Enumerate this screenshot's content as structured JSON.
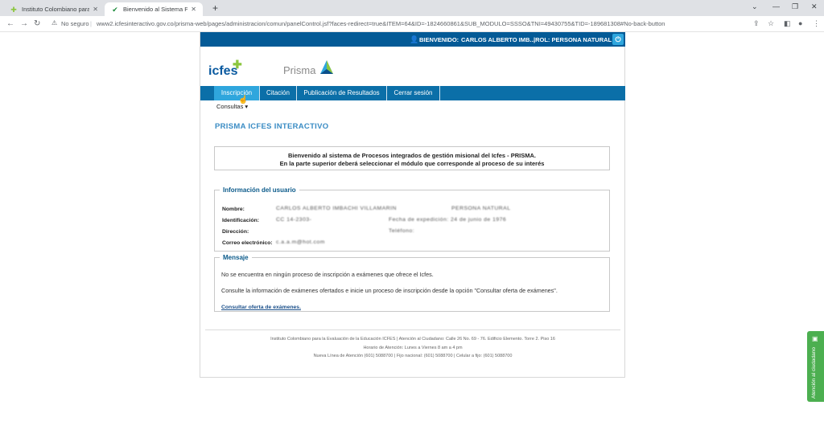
{
  "browser": {
    "tabs": [
      {
        "title": "Instituto Colombiano para la Eva",
        "active": false
      },
      {
        "title": "Bienvenido al Sistema PRISMA",
        "active": true
      }
    ],
    "security_label": "No seguro",
    "url": "www2.icfesinteractivo.gov.co/prisma-web/pages/administracion/comun/panelControl.jsf?faces-redirect=true&ITEM=64&ID=-1824660861&SUB_MODULO=SSSO&TNI=49430755&TID=-189681308#No-back-button"
  },
  "header": {
    "welcome_label": "BIENVENIDO:",
    "user_name": "CARLOS ALBERTO IMB...",
    "role_label": "|ROL:",
    "role_value": "PERSONA NATURAL"
  },
  "logos": {
    "icfes": "icfes",
    "prisma": "Prisma"
  },
  "menu": {
    "items": [
      "Inscripción",
      "Citación",
      "Publicación de Resultados",
      "Cerrar sesión"
    ],
    "submenu": "Consultas ▾"
  },
  "main": {
    "title": "PRISMA ICFES INTERACTIVO",
    "welcome_line1": "Bienvenido al sistema de Procesos integrados de gestión misional del Icfes - PRISMA.",
    "welcome_line2": "En la parte superior deberá seleccionar el módulo que corresponde al proceso de su interés"
  },
  "user_info": {
    "legend": "Información del usuario",
    "labels": {
      "nombre": "Nombre:",
      "identificacion": "Identificación:",
      "direccion": "Dirección:",
      "correo": "Correo electrónico:"
    },
    "blurred": {
      "nombre": "CARLOS ALBERTO IMBACHI VILLAMARIN",
      "rol": "PERSONA NATURAL",
      "identificacion": "CC 14-2303-",
      "fecha": "Fecha de expedición: 24 de junio de 1976",
      "telefono": "Teléfono:",
      "correo": "c.a.a.m@hot.com"
    }
  },
  "message": {
    "legend": "Mensaje",
    "line1": "No se encuentra en ningún proceso de inscripción a exámenes que ofrece el Icfes.",
    "line2": "Consulte la información de exámenes ofertados e inicie un proceso de inscripción desde la opción \"Consultar oferta de exámenes\".",
    "link": "Consultar oferta de exámenes."
  },
  "footer": {
    "line1": "Instituto Colombiano para la Evaluación de la Educación ICFES  |  Atención al Ciudadano: Calle 26 No. 69 - 76. Edificio Elemento. Torre 2. Piso 16",
    "line2": "Horario de Atención: Lunes a Viernes 8 am a 4 pm",
    "line3": "Nueva Línea de Atención (601) 5088700  |  Fijo nacional: (601) 5088700  |  Celular a fijo: (601) 5088700"
  },
  "side_tab": {
    "label": "Atención al ciudadano"
  }
}
